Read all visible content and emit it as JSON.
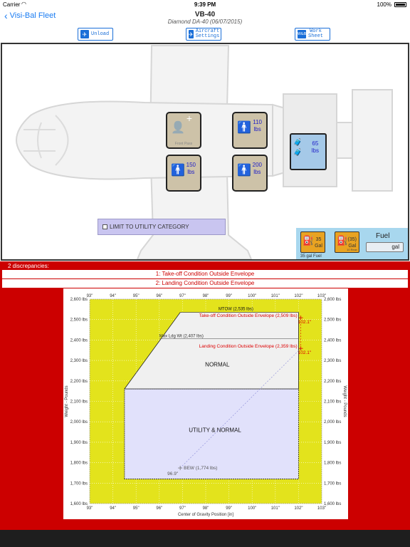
{
  "status_bar": {
    "carrier": "Carrier",
    "time": "9:39 PM",
    "battery": "100%"
  },
  "nav": {
    "back_label": "Visi-Bal Fleet",
    "title": "VB-40",
    "subtitle": "Diamond DA-40 (06/07/2015)"
  },
  "toolbar": {
    "unload_label": "Unload",
    "aircraft_settings_label": [
      "Aircraft",
      "Settings"
    ],
    "worksheet_label": [
      "Work",
      "Sheet"
    ],
    "worksheet_icon_text": "W&B"
  },
  "load": {
    "front_pass_caption": "Front Pass",
    "pilot": {
      "value": "110",
      "unit": "lbs"
    },
    "rear_left": {
      "value": "150",
      "unit": "lbs"
    },
    "rear_right": {
      "value": "200",
      "unit": "lbs"
    },
    "baggage": {
      "value": "65",
      "unit": "lbs"
    },
    "utility_label": "LIMIT TO UTILITY CATEGORY",
    "fuel": {
      "label": "Fuel",
      "main_value": "35",
      "main_unit": "Gal",
      "aux_value": "(35)",
      "aux_unit": "Gal",
      "aux_sub": "10 Reav",
      "input_unit": "gal",
      "caption": "35 gal Fuel"
    }
  },
  "discrepancies": {
    "header": "2 discrepancies:",
    "items": [
      "1: Take-off Condition Outside Envelope",
      "2: Landing Condition Outside Envelope"
    ]
  },
  "chart_data": {
    "type": "scatter",
    "title": "",
    "xlabel": "Center of Gravity Position [in]",
    "ylabel": "Weight - Pounds",
    "xlim": [
      93,
      103
    ],
    "ylim": [
      1600,
      2600
    ],
    "x_ticks": [
      "93\"",
      "94\"",
      "95\"",
      "96\"",
      "97\"",
      "98\"",
      "99\"",
      "100\"",
      "101\"",
      "102\"",
      "103\""
    ],
    "y_ticks": [
      "1,600 lbs",
      "1,700 lbs",
      "1,800 lbs",
      "1,900 lbs",
      "2,000 lbs",
      "2,100 lbs",
      "2,200 lbs",
      "2,300 lbs",
      "2,400 lbs",
      "2,500 lbs",
      "2,600 lbs"
    ],
    "colors": {
      "outer": "#e3e31c",
      "normal": "#f0f0f0",
      "utility": "#e1e1fb",
      "points": "#dd0000"
    },
    "envelope_normal": {
      "label": "NORMAL",
      "points": [
        [
          94.5,
          2161
        ],
        [
          96.9,
          2535
        ],
        [
          102.0,
          2535
        ],
        [
          102.0,
          2161
        ]
      ]
    },
    "envelope_utility": {
      "label": "UTILITY  & NORMAL",
      "points": [
        [
          94.5,
          1720
        ],
        [
          94.5,
          2161
        ],
        [
          102.0,
          2161
        ],
        [
          102.0,
          1720
        ]
      ]
    },
    "limit_lines": [
      {
        "label": "MTOW (2,535 lbs)",
        "y": 2535,
        "x_range": [
          96.9,
          102.0
        ]
      },
      {
        "label": "Max Ldg Wt (2,407 lbs)",
        "y": 2407,
        "x_range": [
          96.0,
          102.0
        ]
      }
    ],
    "points": [
      {
        "name": "Take-off Condition Outside Envelope (2,509 lbs)",
        "x": 102.1,
        "y": 2509,
        "cg_label": "102.1\""
      },
      {
        "name": "Landing Condition Outside Envelope (2,359 lbs)",
        "x": 102.1,
        "y": 2359,
        "cg_label": "102.1\""
      },
      {
        "name": "BEW (1,774 lbs)",
        "x": 96.9,
        "y": 1774,
        "cg_label": "96.9\""
      }
    ]
  }
}
